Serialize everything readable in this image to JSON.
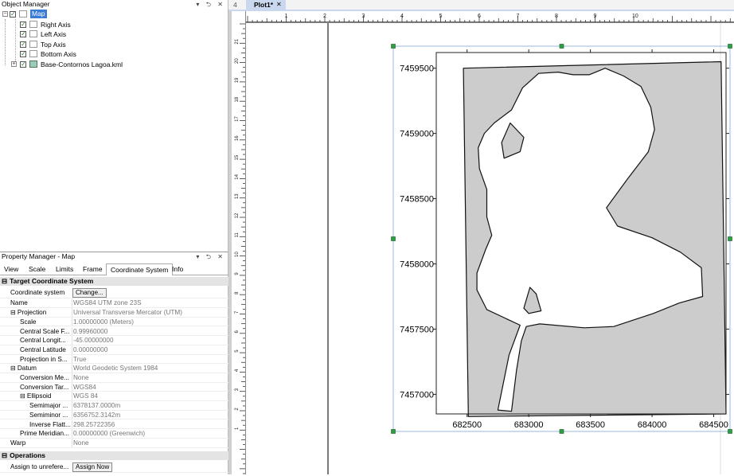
{
  "object_manager": {
    "title": "Object Manager",
    "pane_buttons": "▾ ⮌ ✕",
    "items": [
      {
        "label": "Map",
        "checked": true,
        "selected": true
      },
      {
        "label": "Right Axis",
        "checked": true
      },
      {
        "label": "Left Axis",
        "checked": true
      },
      {
        "label": "Top Axis",
        "checked": true
      },
      {
        "label": "Bottom Axis",
        "checked": true
      },
      {
        "label": "Base-Contornos Lagoa.kml",
        "checked": true
      }
    ]
  },
  "property_manager": {
    "title": "Property Manager - Map",
    "pane_buttons": "▾ ⮌ ✕",
    "tabs": [
      "View",
      "Scale",
      "Limits",
      "Frame",
      "Coordinate System",
      "Info"
    ],
    "active_tab": "Coordinate System",
    "section1": "Target Coordinate System",
    "rows": [
      {
        "name": "Coordinate system",
        "value": "Change..."
      },
      {
        "name": "Name",
        "value": "WGS84 UTM zone 23S"
      },
      {
        "name": "Projection",
        "value": "Universal Transverse Mercator (UTM)"
      },
      {
        "name": "Scale",
        "value": "1.00000000 (Meters)"
      },
      {
        "name": "Central Scale F...",
        "value": "0.99960000"
      },
      {
        "name": "Central Longit...",
        "value": "-45.00000000"
      },
      {
        "name": "Central Latitude",
        "value": "0.00000000"
      },
      {
        "name": "Projection in S...",
        "value": "True"
      },
      {
        "name": "Datum",
        "value": "World Geodetic System 1984"
      },
      {
        "name": "Conversion Me...",
        "value": "None"
      },
      {
        "name": "Conversion Tar...",
        "value": "WGS84"
      },
      {
        "name": "Ellipsoid",
        "value": "WGS 84"
      },
      {
        "name": "Semimajor ...",
        "value": "6378137.0000m"
      },
      {
        "name": "Semiminor ...",
        "value": "6356752.3142m"
      },
      {
        "name": "Inverse Flatt...",
        "value": "298.25722356"
      },
      {
        "name": "Prime Meridian...",
        "value": "0.00000000 (Greenwich)"
      },
      {
        "name": "Warp",
        "value": "None"
      }
    ],
    "section2": "Operations",
    "op_row": {
      "name": "Assign to unrefere...",
      "value": "Assign Now"
    }
  },
  "document": {
    "tab_arrow": "4",
    "tab_label": "Plot1*",
    "tab_close": "✕"
  },
  "ruler": {
    "h_labels": [
      "1",
      "2",
      "3",
      "4",
      "5",
      "6",
      "7",
      "8",
      "9",
      "10"
    ],
    "v_labels": [
      "21",
      "20",
      "19",
      "18",
      "17",
      "16",
      "15",
      "14",
      "13",
      "12",
      "11",
      "10",
      "9",
      "8",
      "7",
      "6",
      "5",
      "4",
      "3",
      "2",
      "1"
    ]
  },
  "chart_data": {
    "type": "map",
    "x_tick_labels": [
      "682500",
      "683000",
      "683500",
      "684000",
      "684500"
    ],
    "y_tick_labels": [
      "7459500",
      "7459000",
      "7458500",
      "7458000",
      "7457500",
      "7457000"
    ],
    "xlim": [
      682250,
      684600
    ],
    "ylim": [
      7456850,
      7459620
    ],
    "fill_color": "#cccccc",
    "lake_color": "#ffffff",
    "polygons": {
      "land": [
        [
          682470,
          7459500
        ],
        [
          684560,
          7459550
        ],
        [
          684600,
          7456850
        ],
        [
          682510,
          7456830
        ]
      ],
      "lake": [
        [
          682860,
          7459180
        ],
        [
          682950,
          7459350
        ],
        [
          683080,
          7459460
        ],
        [
          683240,
          7459470
        ],
        [
          683360,
          7459450
        ],
        [
          683490,
          7459450
        ],
        [
          683620,
          7459500
        ],
        [
          683770,
          7459440
        ],
        [
          683910,
          7459360
        ],
        [
          683990,
          7459200
        ],
        [
          684020,
          7459030
        ],
        [
          683970,
          7458860
        ],
        [
          683800,
          7458650
        ],
        [
          683630,
          7458430
        ],
        [
          683720,
          7458290
        ],
        [
          684000,
          7458200
        ],
        [
          684230,
          7458090
        ],
        [
          684400,
          7457970
        ],
        [
          684410,
          7457750
        ],
        [
          684220,
          7457700
        ],
        [
          684010,
          7457620
        ],
        [
          683690,
          7457520
        ],
        [
          683450,
          7457510
        ],
        [
          683090,
          7457540
        ],
        [
          682980,
          7457520
        ],
        [
          682940,
          7457410
        ],
        [
          682900,
          7457180
        ],
        [
          682860,
          7456870
        ],
        [
          682750,
          7456880
        ],
        [
          682840,
          7457300
        ],
        [
          682930,
          7457530
        ],
        [
          682660,
          7457650
        ],
        [
          682580,
          7457800
        ],
        [
          682580,
          7457930
        ],
        [
          682650,
          7458110
        ],
        [
          682700,
          7458220
        ],
        [
          682660,
          7458360
        ],
        [
          682660,
          7458570
        ],
        [
          682600,
          7458730
        ],
        [
          682590,
          7458890
        ],
        [
          682640,
          7459000
        ],
        [
          682720,
          7459080
        ]
      ],
      "islands": [
        [
          [
            682850,
            7459080
          ],
          [
            682960,
            7458970
          ],
          [
            682930,
            7458860
          ],
          [
            682800,
            7458810
          ],
          [
            682780,
            7458930
          ]
        ],
        [
          [
            683010,
            7457820
          ],
          [
            683060,
            7457770
          ],
          [
            683100,
            7457640
          ],
          [
            683000,
            7457620
          ],
          [
            682960,
            7457660
          ]
        ]
      ]
    }
  }
}
